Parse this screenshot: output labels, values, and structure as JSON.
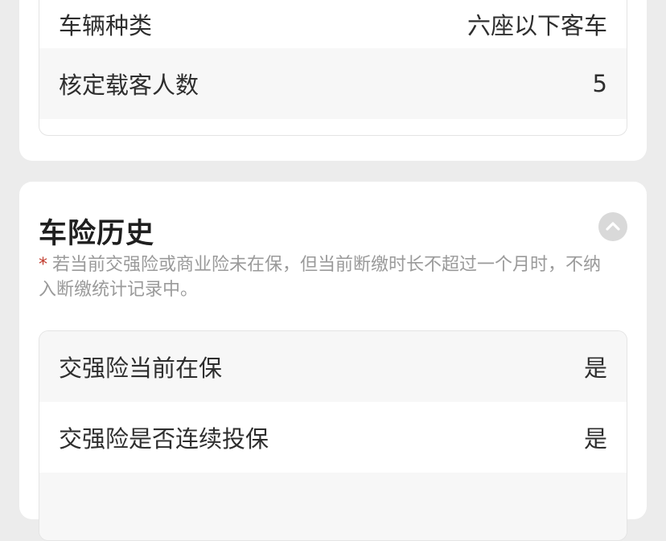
{
  "vehicle_info": {
    "rows": [
      {
        "label": "车辆种类",
        "value": "六座以下客车"
      },
      {
        "label": "核定载客人数",
        "value": "5"
      }
    ]
  },
  "insurance_history": {
    "title": "车险历史",
    "collapse_icon": "chevron-up-icon",
    "note_marker": "*",
    "note": "若当前交强险或商业险未在保，但当前断缴时长不超过一个月时，不纳入断缴统计记录中。",
    "rows": [
      {
        "label": "交强险当前在保",
        "value": "是"
      },
      {
        "label": "交强险是否连续投保",
        "value": "是"
      }
    ]
  }
}
